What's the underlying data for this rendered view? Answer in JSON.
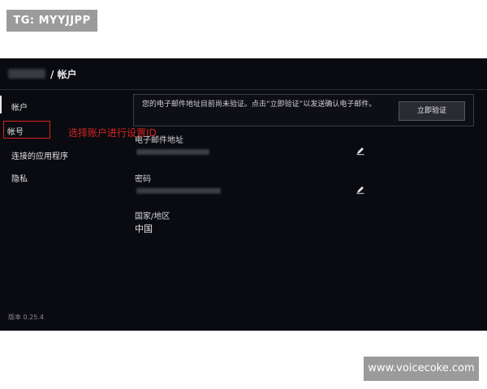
{
  "watermarks": {
    "top_left": "TG: MYYJJPP",
    "bottom_right": "www.voicecoke.com"
  },
  "header": {
    "separator": "/",
    "title": "帐户"
  },
  "sidebar": {
    "items": [
      {
        "label": "帐户"
      },
      {
        "label": "帐号"
      },
      {
        "label": "连接的应用程序"
      },
      {
        "label": "隐私"
      }
    ],
    "version": "版本 0.25.4"
  },
  "annotation": {
    "text": "选择账户进行设置ID",
    "color": "#d5251f"
  },
  "notice": {
    "message": "您的电子邮件地址目前尚未验证。点击“立即验证”以发送确认电子邮件。",
    "button_label": "立即验证"
  },
  "fields": {
    "email_label": "电子邮件地址",
    "password_label": "密码",
    "region_label": "国家/地区",
    "region_value": "中国"
  },
  "colors": {
    "background": "#0a0b10",
    "annotation_red": "#d5251f"
  },
  "icons": {
    "edit": "pencil-icon"
  }
}
